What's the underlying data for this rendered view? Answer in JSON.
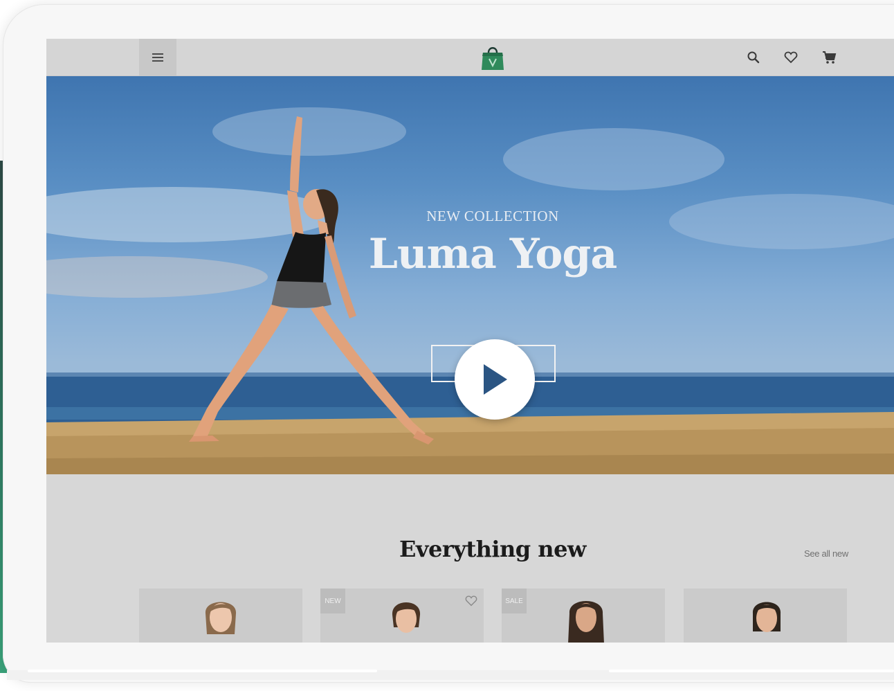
{
  "app": {
    "logo_icon": "shopping-bag-logo-icon",
    "accent_color": "#2f8a5b"
  },
  "header": {
    "menu_icon": "hamburger-menu-icon",
    "search_icon": "search-icon",
    "wishlist_icon": "heart-icon",
    "cart_icon": "shopping-cart-icon"
  },
  "hero": {
    "kicker": "NEW COLLECTION",
    "title": "Luma Yoga",
    "play_icon": "play-icon"
  },
  "new_section": {
    "title": "Everything new",
    "see_all": "See all new",
    "products": [
      {
        "badge": "",
        "has_wishlist": false,
        "hair": "#8a6a4c",
        "top": "#f1f1f1"
      },
      {
        "badge": "NEW",
        "has_wishlist": true,
        "hair": "#4a3424",
        "top": "#2c2c2c"
      },
      {
        "badge": "SALE",
        "has_wishlist": false,
        "hair": "#3a2a20",
        "top": "#d9a9a3"
      },
      {
        "badge": "",
        "has_wishlist": false,
        "hair": "#2e241c",
        "top": "#2a2a2a"
      }
    ]
  }
}
